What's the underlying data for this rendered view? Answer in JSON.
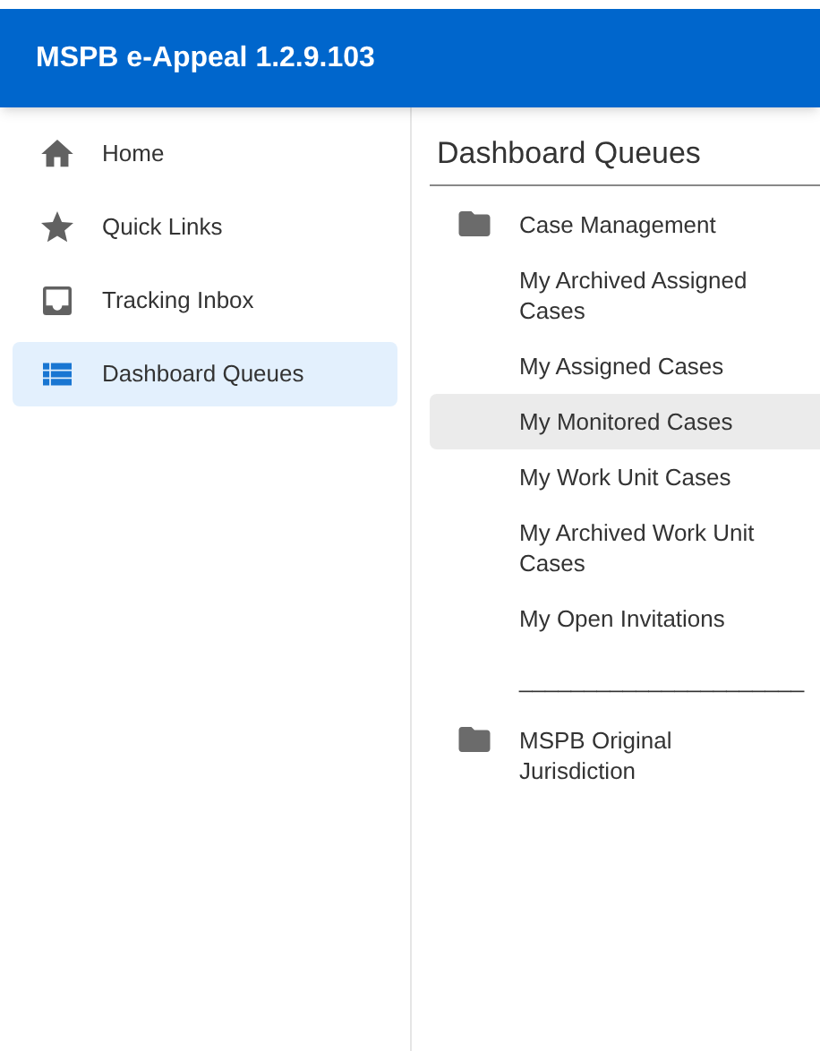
{
  "app_bar": {
    "title": "MSPB e-Appeal 1.2.9.103"
  },
  "sidebar": {
    "items": [
      {
        "label": "Home",
        "kind": "home",
        "selected": false
      },
      {
        "label": "Quick Links",
        "kind": "star",
        "selected": false
      },
      {
        "label": "Tracking Inbox",
        "kind": "inbox",
        "selected": false
      },
      {
        "label": "Dashboard Queues",
        "kind": "list",
        "selected": true
      }
    ]
  },
  "content": {
    "title": "Dashboard Queues",
    "queues": [
      {
        "kind": "folder",
        "label": "Case Management"
      },
      {
        "kind": "item",
        "label": "My Archived Assigned Cases",
        "selected": false
      },
      {
        "kind": "item",
        "label": "My Assigned Cases",
        "selected": false
      },
      {
        "kind": "item",
        "label": "My Monitored Cases",
        "selected": true
      },
      {
        "kind": "item",
        "label": "My Work Unit Cases",
        "selected": false
      },
      {
        "kind": "item",
        "label": "My Archived Work Unit Cases",
        "selected": false
      },
      {
        "kind": "item",
        "label": "My Open Invitations",
        "selected": false
      },
      {
        "kind": "separator",
        "label": "______________________"
      },
      {
        "kind": "folder",
        "label": "MSPB Original Jurisdiction"
      }
    ]
  }
}
